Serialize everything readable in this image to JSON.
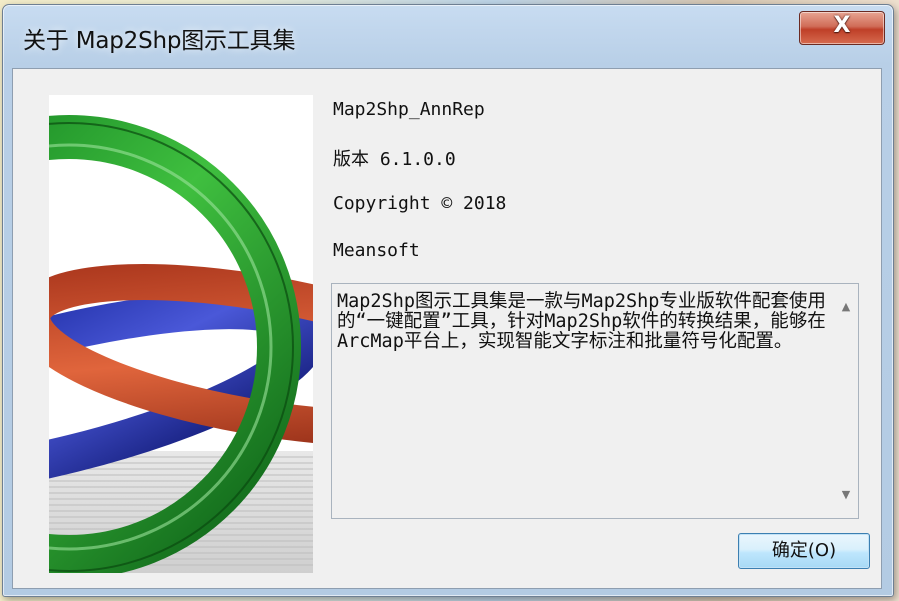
{
  "window": {
    "title": "关于 Map2Shp图示工具集",
    "close_label": "X"
  },
  "about": {
    "product_name": "Map2Shp_AnnRep",
    "version": "版本 6.1.0.0",
    "copyright": "Copyright © 2018",
    "company": "Meansoft",
    "description": "Map2Shp图示工具集是一款与Map2Shp专业版软件配套使用的“一键配置”工具，针对Map2Shp软件的转换结果，能够在ArcMap平台上，实现智能文字标注和批量符号化配置。"
  },
  "buttons": {
    "ok_label": "确定(O)"
  },
  "colors": {
    "ring_green": "#1f9a2e",
    "ring_red": "#d24a2a",
    "ring_blue": "#2f3fb8",
    "close_red": "#c8452c"
  },
  "icons": {
    "scroll_up": "scroll-up-arrow-icon",
    "scroll_down": "scroll-down-arrow-icon"
  }
}
